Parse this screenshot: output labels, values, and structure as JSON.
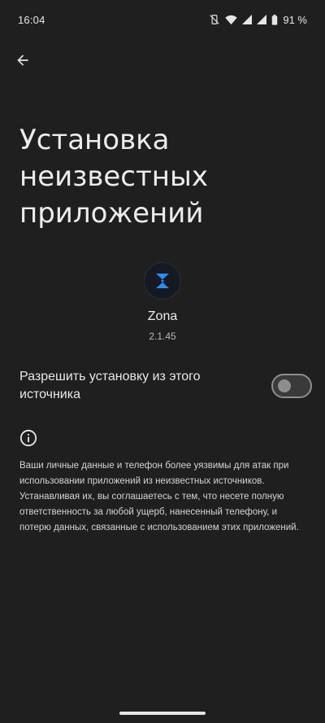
{
  "status_bar": {
    "time": "16:04",
    "battery": "91 %"
  },
  "page": {
    "title": "Установка неизвестных приложений"
  },
  "app": {
    "name": "Zona",
    "version": "2.1.45",
    "icon": "zona-logo-icon"
  },
  "setting": {
    "label": "Разрешить установку из этого источника",
    "enabled": false
  },
  "info": {
    "text": "Ваши личные данные и телефон более уязвимы для атак при использовании приложений из неизвестных источников. Устанавливая их, вы соглашаетесь с тем, что несете полную ответственность за любой ущерб, нанесенный телефону, и потерю данных, связанные с использованием этих приложений."
  },
  "colors": {
    "background": "#1f1f1f",
    "accent": "#2d8cff",
    "switch_off": "#8e8e8e"
  }
}
